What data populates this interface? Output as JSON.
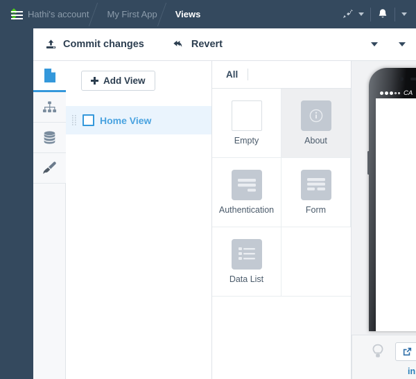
{
  "header": {
    "logo_icon": "green-diamond-logo",
    "breadcrumb": [
      {
        "label": "Hathi's account",
        "active": false
      },
      {
        "label": "My First App",
        "active": false
      },
      {
        "label": "Views",
        "active": true
      }
    ],
    "right_items": [
      {
        "icon": "rocket-icon",
        "name": "deploy-menu",
        "has_chevron": true
      },
      {
        "icon": "bell-icon",
        "name": "notifications",
        "has_chevron": false
      },
      {
        "icon": "chevron-down-icon",
        "name": "account-menu",
        "has_chevron": true
      }
    ]
  },
  "toolbar": {
    "menu_icon": "hamburger-icon",
    "commit_label": "Commit changes",
    "commit_icon": "upload-icon",
    "revert_label": "Revert",
    "revert_icon": "undo-arrow-icon",
    "chevrons": [
      "chevron-down-icon",
      "chevron-down-icon"
    ]
  },
  "icon_rail": {
    "items": [
      {
        "name": "pages-icon",
        "active": true
      },
      {
        "name": "sitemap-icon",
        "active": false
      },
      {
        "name": "database-icon",
        "active": false
      },
      {
        "name": "paintbrush-icon",
        "active": false
      }
    ]
  },
  "views_panel": {
    "add_button_label": "Add View",
    "views": [
      {
        "label": "Home View",
        "selected": true,
        "icon": "square-outline-icon"
      }
    ]
  },
  "templates_panel": {
    "tabs": [
      {
        "label": "All",
        "active": true
      }
    ],
    "items": [
      {
        "label": "Empty",
        "icon": "blank-square-icon",
        "hover": false
      },
      {
        "label": "About",
        "icon": "info-icon",
        "hover": true
      },
      {
        "label": "Authentication",
        "icon": "auth-form-icon",
        "hover": false
      },
      {
        "label": "Form",
        "icon": "form-icon",
        "hover": false
      },
      {
        "label": "Data List",
        "icon": "list-icon",
        "hover": false
      }
    ]
  },
  "preview": {
    "device": "phone-mockup",
    "status_bar": {
      "signal": "●●●○○",
      "carrier": "CA"
    }
  },
  "bottom_bar": {
    "bulb_icon": "lightbulb-icon",
    "external_icon": "external-link-icon",
    "link_text": "in"
  },
  "colors": {
    "header_bg": "#34495e",
    "accent_blue": "#3498db",
    "selected_row": "#eaf4fd",
    "logo_green": "#4fd11a",
    "panel_border": "#dfe3e8",
    "thumb_grey": "#c2c9d2"
  }
}
